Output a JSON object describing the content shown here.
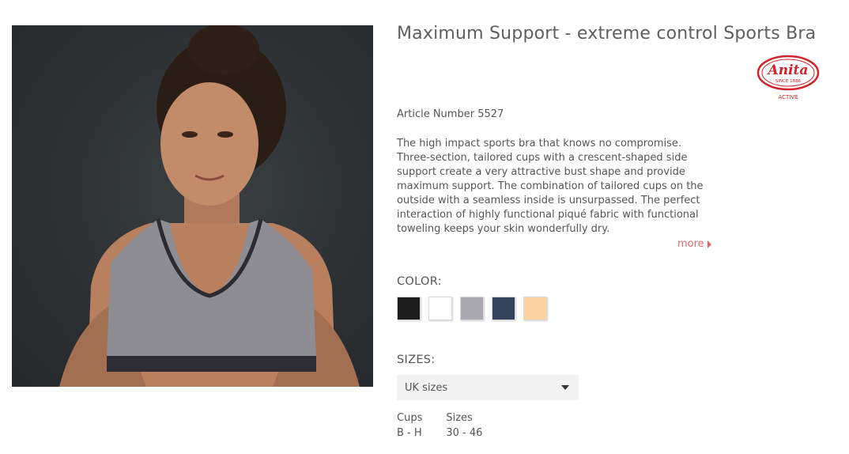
{
  "product": {
    "title": "Maximum Support - extreme control Sports Bra",
    "article_number": "Article Number 5527",
    "description": "The high impact sports bra that knows no compromise. Three-section, tailored cups with a crescent-shaped side support create a very attractive bust shape and provide maximum support. The combination of tailored cups on the outside with a seamless inside is unsurpassed. The perfect interaction of highly functional piqué fabric with functional toweling keeps your skin wonderfully dry.",
    "more_label": "more",
    "more_icon": "triangle-right-icon"
  },
  "brand": {
    "name": "Anita",
    "since": "SINCE 1886",
    "line": "ACTIVE",
    "color": "#d2232a"
  },
  "color_section": {
    "label": "COLOR:",
    "swatches": [
      {
        "color": "#1c1c1c"
      },
      {
        "color": "#ffffff"
      },
      {
        "color": "#a9a8b1"
      },
      {
        "color": "#34445c"
      },
      {
        "color": "#fdd3a0"
      }
    ]
  },
  "sizes_section": {
    "label": "SIZES:",
    "selected": "UK sizes",
    "icon": "chevron-down-icon",
    "table": {
      "cups_header": "Cups",
      "cups_value": "B - H",
      "sizes_header": "Sizes",
      "sizes_value": "30 - 46"
    }
  }
}
